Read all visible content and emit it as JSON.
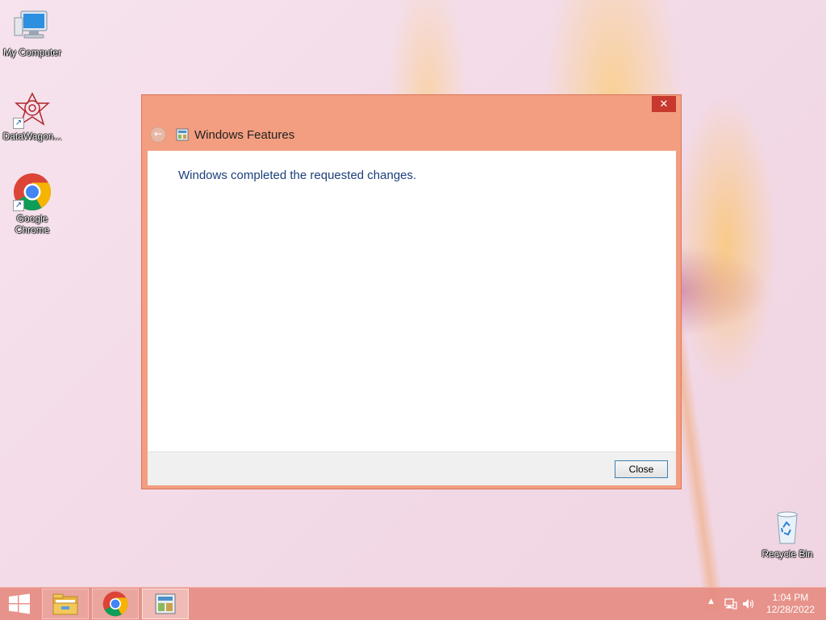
{
  "desktop": {
    "icons": [
      {
        "label": "My Computer",
        "icon": "my-computer-icon"
      },
      {
        "label": "DataWagon...",
        "icon": "datawagon-icon"
      },
      {
        "label": "Google Chrome",
        "icon": "chrome-icon"
      },
      {
        "label": "Recycle Bin",
        "icon": "recycle-bin-icon"
      }
    ]
  },
  "dialog": {
    "title": "Windows Features",
    "close_glyph": "✕",
    "message": "Windows completed the requested changes.",
    "close_button": "Close"
  },
  "taskbar": {
    "items": [
      {
        "name": "start",
        "icon": "windows-logo-icon"
      },
      {
        "name": "file-explorer",
        "icon": "folder-icon"
      },
      {
        "name": "chrome",
        "icon": "chrome-icon"
      },
      {
        "name": "windows-features",
        "icon": "windows-features-icon"
      }
    ],
    "tray": {
      "time": "1:04 PM",
      "date": "12/28/2022",
      "expand_glyph": "▲"
    }
  },
  "colors": {
    "accent": "#f39e80",
    "taskbar": "#e68c82",
    "message_text": "#1b3f7a"
  }
}
